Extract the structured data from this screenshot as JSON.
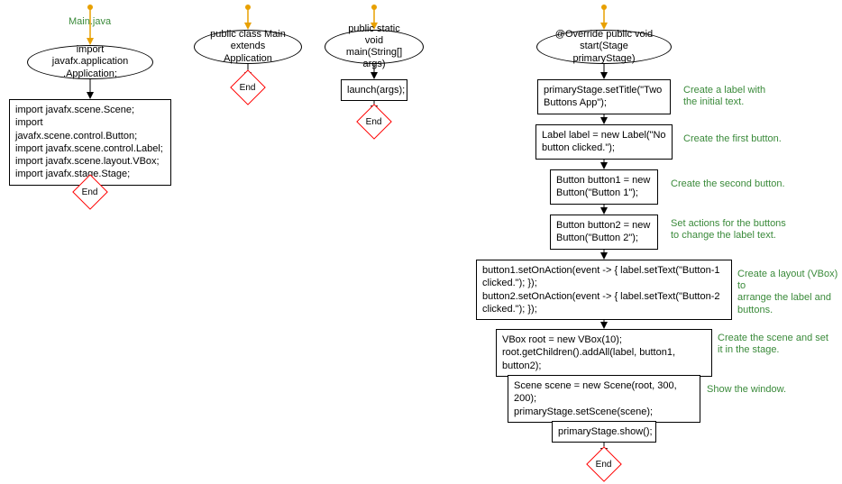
{
  "col1": {
    "title": "Main.java",
    "n1": "import javafx.application\n.Application;",
    "n2": "import javafx.scene.Scene;\nimport javafx.scene.control.Button;\nimport javafx.scene.control.Label;\nimport javafx.scene.layout.VBox;\nimport javafx.stage.Stage;",
    "end": "End"
  },
  "col2": {
    "n1": "public class Main\nextends Application",
    "end": "End"
  },
  "col3": {
    "n1": "public static void\nmain(String[] args)",
    "n2": "launch(args);",
    "end": "End"
  },
  "col4": {
    "n1": "@Override public void\nstart(Stage primaryStage)",
    "n2": "primaryStage.setTitle(\"Two\nButtons App\");",
    "n3": "Label label = new Label(\"No\nbutton clicked.\");",
    "n4": "Button button1 = new\nButton(\"Button 1\");",
    "n5": "Button button2 = new\nButton(\"Button 2\");",
    "n6": "button1.setOnAction(event -> { label.setText(\"Button-1\nclicked.\"); });\nbutton2.setOnAction(event -> { label.setText(\"Button-2\nclicked.\"); });",
    "n7": "VBox root = new VBox(10);\nroot.getChildren().addAll(label, button1, button2);",
    "n8": "Scene scene = new Scene(root, 300, 200);\nprimaryStage.setScene(scene);",
    "n9": "primaryStage.show();",
    "end": "End",
    "c1": "Create a label with\nthe initial text.",
    "c2": "Create the first button.",
    "c3": "Create the second button.",
    "c4": "Set actions for the buttons\nto change the label text.",
    "c5": "Create a layout (VBox) to\narrange the label and\nbuttons.",
    "c6": "Create the scene and set\nit in the stage.",
    "c7": "Show the window."
  }
}
